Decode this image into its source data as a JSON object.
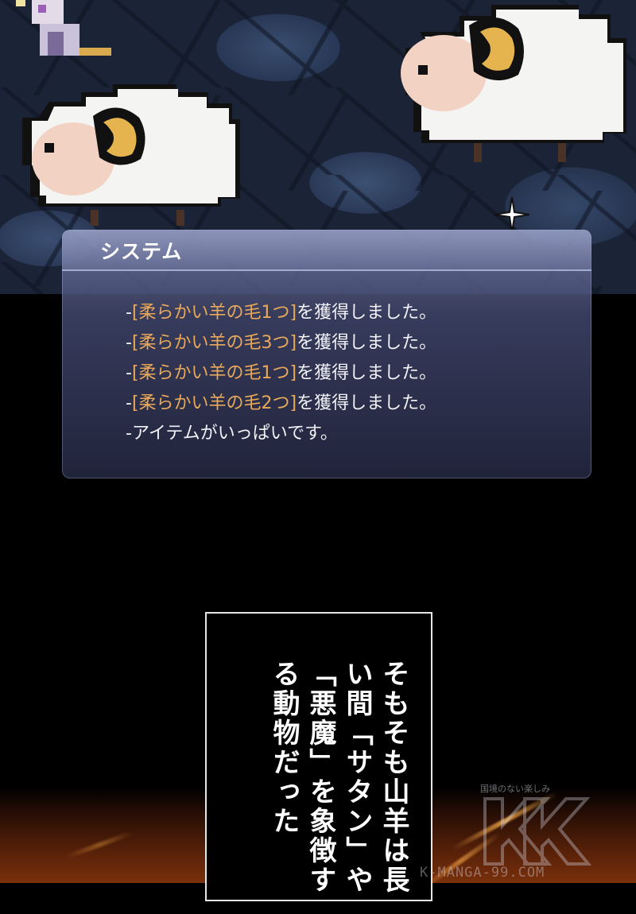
{
  "system_window": {
    "title": "システム",
    "lines": [
      {
        "prefix": "-",
        "item": "[柔らかい羊の毛1つ]",
        "suffix": "を獲得しました。"
      },
      {
        "prefix": "-",
        "item": "[柔らかい羊の毛3つ]",
        "suffix": "を獲得しました。"
      },
      {
        "prefix": "-",
        "item": "[柔らかい羊の毛1つ]",
        "suffix": "を獲得しました。"
      },
      {
        "prefix": "-",
        "item": "[柔らかい羊の毛2つ]",
        "suffix": "を獲得しました。"
      },
      {
        "prefix": "-",
        "item": "",
        "suffix": "アイテムがいっぱいです。"
      }
    ]
  },
  "narration": {
    "text": "そもそも山羊は長い間「サタン」や「悪魔」を象徴する動物だった"
  },
  "watermark": {
    "tagline": "国境のない楽しみ",
    "url": "K-MANGA-99.COM"
  },
  "colors": {
    "item_highlight": "#e9a85a",
    "window_bg": "#464c76"
  }
}
